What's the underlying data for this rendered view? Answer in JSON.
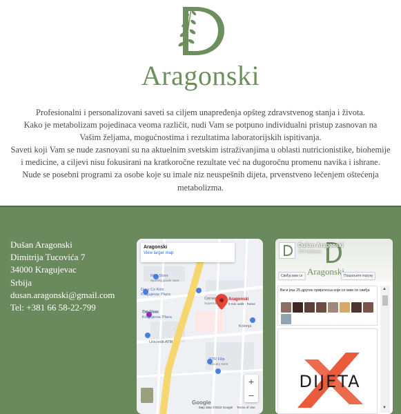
{
  "brand": {
    "name": "Aragonski",
    "monogram": "D"
  },
  "intro": {
    "lines": [
      "Profesionalni i personalizovani saveti sa ciljem unapređenja opšteg zdravstvenog stanja i života.",
      "Kako je metabolizam pojedinaca veoma različit, nudi Vam se potpuno individualni pristup zasnovan na",
      "Vašim željama, mogućnostima i rezultatima laboratorijskih ispitivanja.",
      "Saveti koji Vam se nude zasnovani su na aktuelnim svetskim istraživanjima u oblasti nutricionistike, biohemije",
      "i medicine, a ciljevi nisu fokusirani na kratkoročne rezultate već na dugoročnu promenu navika i ishrane.",
      "Nude se posebni programi za osobe koje su imale niz neuspešnih dijeta, prvenstveno lečenjem oštećenja",
      "metabolizma."
    ]
  },
  "contact": {
    "name": "Dušan Aragonski",
    "street": "Dimitrija Tucovića 7",
    "city": "34000 Kragujevac",
    "country": "Srbija",
    "email": "dusan.aragonski@gmail.com",
    "phone": "Tel: +381 66 58-22-799"
  },
  "map": {
    "place_title": "Aragonski",
    "view_larger": "View larger map",
    "pin_label": "Aragonski",
    "pin_sub": "5 min walk · home",
    "labels": {
      "nike": "Nike Store",
      "nike_sub": "Sporting goods store",
      "dexy": "Dexy Co Kids",
      "dexy2": "Kragujevac Plaza",
      "corner": "Corner shop",
      "corner_sub": "Supermarket",
      "cineplexx": "Cineplexx",
      "cineplexx2": "Kragujevac Plaza",
      "unicredit": "Unicredit ATM",
      "kolonja": "Kolonja",
      "strfilip": "STR Filip",
      "strfilip_sub": "Grocery store",
      "top": "Top Shop",
      "street1": "Dobrile...",
      "street2": "Zelenga..."
    },
    "zoom_in": "+",
    "zoom_out": "−",
    "google": "Google",
    "map_data": "Map data ©2022 Google",
    "terms": "Terms of Use"
  },
  "facebook": {
    "page_name": "Dušan Aragonski",
    "followers": "133 свиђања",
    "like_button": "Свиђа вам се",
    "message_button": "Пошаљите поруку",
    "friends_text": "Ви и још 25 других пријатеља који се вам се свиђа",
    "cover_brand": "Aragonski",
    "post_word": "DIJETA"
  },
  "colors": {
    "brand_green": "#6d8f5d",
    "footer_green": "#6a8a5d",
    "text_grey": "#4a4a4a"
  }
}
